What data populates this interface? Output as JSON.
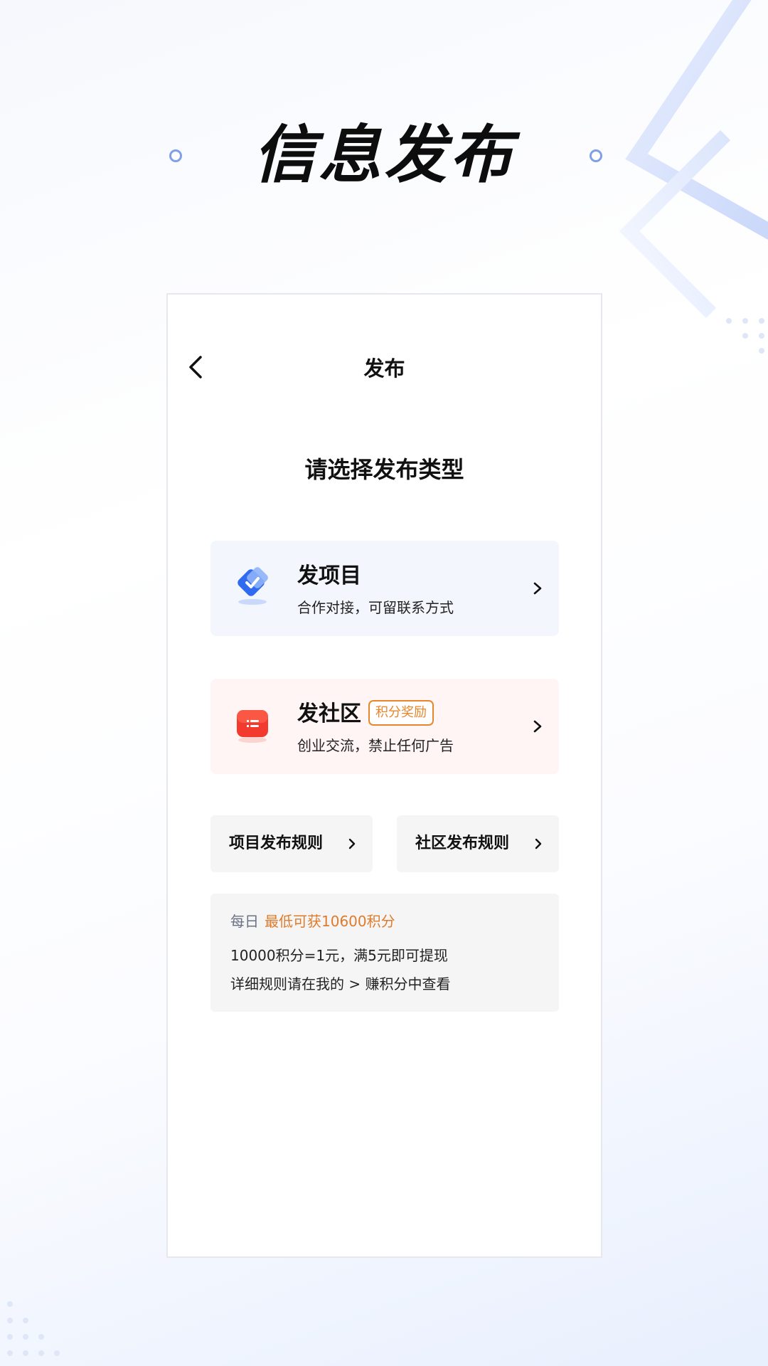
{
  "hero": {
    "title": "信息发布"
  },
  "nav": {
    "title": "发布",
    "back_icon": "chevron-left-icon"
  },
  "main": {
    "section_title": "请选择发布类型",
    "options": [
      {
        "title": "发项目",
        "subtitle": "合作对接，可留联系方式",
        "icon": "handshake-icon",
        "accent": "#2f6bf0",
        "background": "#f3f7fd"
      },
      {
        "title": "发社区",
        "badge": "积分奖励",
        "subtitle": "创业交流，禁止任何广告",
        "icon": "chat-bubble-icon",
        "accent": "#f23a2e",
        "background": "#fff5f5"
      }
    ],
    "rules": [
      {
        "label": "项目发布规则"
      },
      {
        "label": "社区发布规则"
      }
    ],
    "info": {
      "daily_label": "每日",
      "highlight": "最低可获10600积分",
      "line2": "10000积分=1元，满5元即可提现",
      "line3": "详细规则请在我的 > 赚积分中查看",
      "highlight_color": "#e07b2b"
    }
  }
}
